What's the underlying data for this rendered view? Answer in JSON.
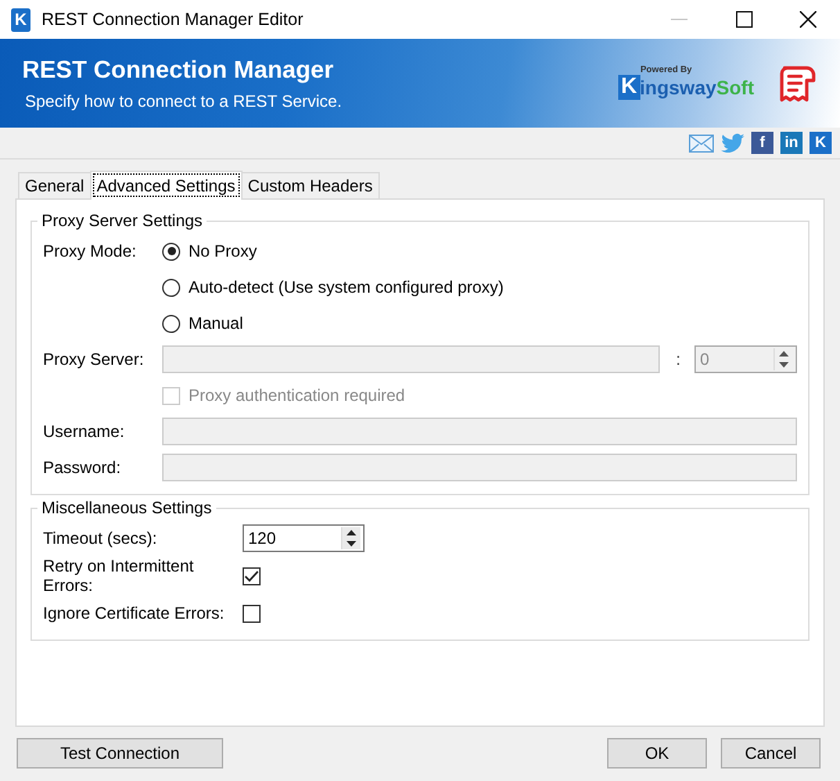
{
  "window": {
    "icon_glyph": "K",
    "title": "REST Connection Manager Editor"
  },
  "banner": {
    "title": "REST Connection Manager",
    "subtitle": "Specify how to connect to a REST Service.",
    "logo": {
      "tagline": "Powered By",
      "initial": "K",
      "name": "ingsway",
      "suffix": "Soft"
    }
  },
  "share_icons": [
    {
      "kind": "mail",
      "color": "#5a9fd8"
    },
    {
      "kind": "bird",
      "color": "#45a6e8"
    },
    {
      "kind": "glyph",
      "glyph": "f",
      "color": "#3b5998"
    },
    {
      "kind": "glyph",
      "glyph": "in",
      "color": "#1a78b8"
    },
    {
      "kind": "glyph",
      "glyph": "K",
      "color": "#1b6fc8"
    }
  ],
  "tabs": [
    {
      "label": "General",
      "selected": false
    },
    {
      "label": "Advanced Settings",
      "selected": true
    },
    {
      "label": "Custom Headers",
      "selected": false
    }
  ],
  "proxy": {
    "legend": "Proxy Server Settings",
    "mode_label": "Proxy Mode:",
    "modes": [
      {
        "label": "No Proxy",
        "selected": true
      },
      {
        "label": "Auto-detect (Use system configured proxy)",
        "selected": false
      },
      {
        "label": "Manual",
        "selected": false
      }
    ],
    "fields_disabled": true,
    "server_label": "Proxy Server:",
    "port_sep": ":",
    "port": "0",
    "auth": {
      "label": "Proxy authentication required",
      "checked": false
    },
    "username_label": "Username:",
    "password_label": "Password:"
  },
  "misc": {
    "legend": "Miscellaneous Settings",
    "timeout_label": "Timeout (secs):",
    "timeout": "120",
    "options": [
      {
        "label": "Retry on Intermittent Errors:",
        "checked": true
      },
      {
        "label": "Ignore Certificate Errors:",
        "checked": false
      }
    ]
  },
  "buttons": {
    "left": [
      "Test Connection"
    ],
    "right": [
      "OK",
      "Cancel"
    ]
  }
}
